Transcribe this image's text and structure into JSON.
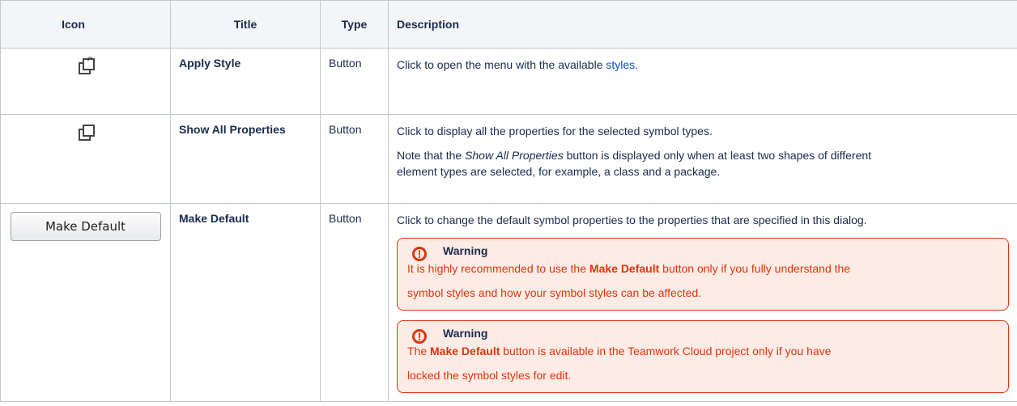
{
  "headers": {
    "icon": "Icon",
    "title": "Title",
    "type": "Type",
    "description": "Description"
  },
  "rows": [
    {
      "icon_name": "apply-style-icon",
      "title": "Apply Style",
      "type": "Button",
      "desc_prefix": "Click to open the menu with the available ",
      "desc_link": "styles",
      "desc_suffix": "."
    },
    {
      "icon_name": "show-all-properties-icon",
      "title": "Show All Properties",
      "type": "Button",
      "desc_line1": "Click to display all the properties for the selected symbol types.",
      "note_prefix": "Note that the ",
      "note_italic": "Show All Properties",
      "note_suffix": " button is displayed only when at least two shapes of different",
      "note_line2": "element types are selected, for example, a class and a package."
    },
    {
      "icon_button_label": "Make Default",
      "title": "Make Default",
      "type": "Button",
      "desc_line1": "Click to change the default symbol properties to the properties that are specified in this dialog.",
      "warnings": [
        {
          "title": "Warning",
          "prefix": "It is highly recommended to use the ",
          "bold": "Make Default",
          "suffix": " button only if you fully understand the",
          "line2": "symbol styles and how your symbol styles can be affected."
        },
        {
          "title": "Warning",
          "prefix": "The ",
          "bold": "Make Default",
          "suffix": " button is available in the Teamwork Cloud project only if you have",
          "line2": "locked the symbol styles for edit."
        }
      ]
    }
  ],
  "colors": {
    "link": "#0052cc",
    "warning": "#de350b",
    "warning_bg": "#ffebe6",
    "header_bg": "#f4f5f7"
  }
}
